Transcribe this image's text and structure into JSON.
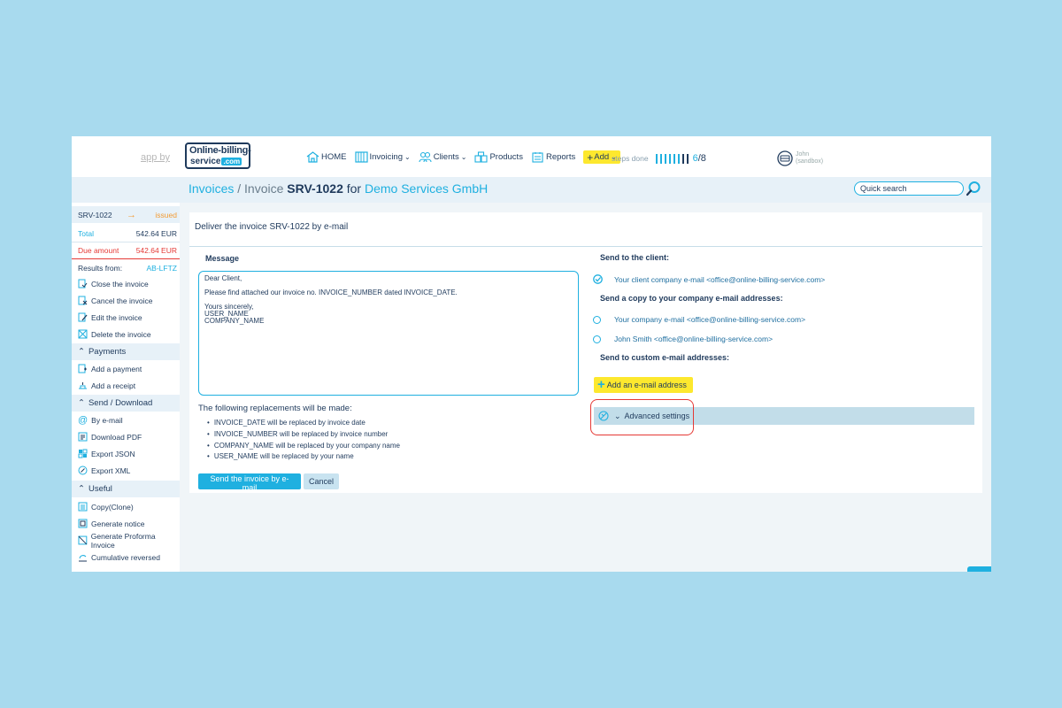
{
  "header": {
    "app_by": "app by",
    "logo_line1": "Online-billing-",
    "logo_line2": "service",
    "logo_suffix": ".com",
    "nav": [
      {
        "label": "HOME",
        "icon": "home-icon"
      },
      {
        "label": "Invoicing",
        "icon": "invoice-icon",
        "dropdown": true
      },
      {
        "label": "Clients",
        "icon": "clients-icon",
        "dropdown": true
      },
      {
        "label": "Products",
        "icon": "products-icon"
      },
      {
        "label": "Reports",
        "icon": "reports-icon"
      }
    ],
    "add_label": "Add",
    "steps_label": "steps done",
    "steps_done": "6",
    "steps_total": "/8",
    "user_name": "John",
    "user_mode": "(sandbox)"
  },
  "titlebar": {
    "section": "Invoices",
    "separator": "/",
    "prefix": "Invoice",
    "invoice_no": "SRV-1022",
    "for_word": "for",
    "client": "Demo Services GmbH",
    "search_placeholder": "Quick search"
  },
  "sidebar": {
    "invoice_no": "SRV-1022",
    "arrow": "→",
    "status": "issued",
    "total_label": "Total",
    "total_value": "542.64 EUR",
    "due_label": "Due amount",
    "due_value": "542.64 EUR",
    "results_label": "Results from:",
    "results_value": "AB-LFTZ",
    "main_items": [
      "Close the invoice",
      "Cancel the invoice",
      "Edit the invoice",
      "Delete the invoice"
    ],
    "payments_head": "Payments",
    "payments_items": [
      "Add a payment",
      "Add a receipt"
    ],
    "send_head": "Send / Download",
    "send_items": [
      "By e-mail",
      "Download PDF",
      "Export JSON",
      "Export XML"
    ],
    "useful_head": "Useful",
    "useful_items": [
      "Copy(Clone)",
      "Generate notice",
      "Generate Proforma Invoice",
      "Cumulative reversed"
    ]
  },
  "form": {
    "title": "Deliver the invoice SRV-1022 by e-mail",
    "message_label": "Message",
    "message_lines": [
      "Dear Client,",
      "",
      "Please find attached our invoice no. INVOICE_NUMBER dated INVOICE_DATE.",
      "",
      "Yours sincerely,",
      "USER_NAME",
      "COMPANY_NAME"
    ],
    "replacements_title": "The following replacements will be made:",
    "replacements": [
      "INVOICE_DATE will be replaced by invoice date",
      "INVOICE_NUMBER will be replaced by invoice number",
      "COMPANY_NAME will be replaced by your company name",
      "USER_NAME will be replaced by your name"
    ],
    "send_button": "Send the invoice by e-mail",
    "cancel_button": "Cancel"
  },
  "recipients": {
    "client_head": "Send to the client:",
    "client_option": "Your client company e-mail <office@online-billing-service.com>",
    "copy_head": "Send a copy to your company e-mail addresses:",
    "copy_options": [
      "Your company e-mail <office@online-billing-service.com>",
      "John Smith <office@online-billing-service.com>"
    ],
    "custom_head": "Send to custom e-mail addresses:",
    "add_email": "Add an e-mail address",
    "advanced": "Advanced settings"
  },
  "colors": {
    "accent": "#1fb0e0",
    "navy": "#1f3a5c",
    "highlight": "#fde82e",
    "danger": "#e53935",
    "status": "#f39c35"
  }
}
